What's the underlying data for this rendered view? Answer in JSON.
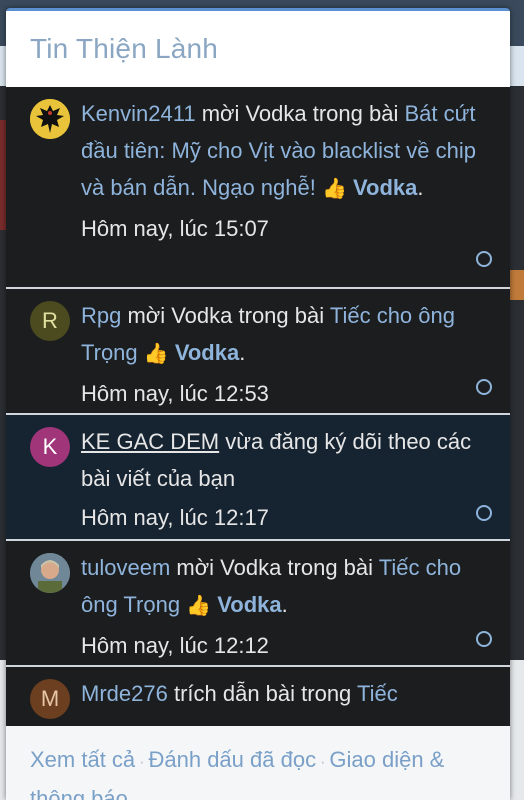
{
  "popup": {
    "title": "Tin Thiện Lành"
  },
  "items": [
    {
      "user": "Kenvin2411",
      "action": " mời Vodka trong bài ",
      "thread": "Bát cứt đầu tiên: Mỹ cho Vịt vào blacklist về chip và bán dẫn. Ngạo nghễ! ",
      "reaction_icon": "👍",
      "reaction_name": "Vodka",
      "suffix": ".",
      "time": "Hôm nay, lúc 15:07",
      "avatar_letter": "",
      "avatar_icon": "eagle-emblem-icon",
      "unread": false
    },
    {
      "user": "Rpg",
      "action": " mời Vodka trong bài ",
      "thread": "Tiếc cho ông Trọng ",
      "reaction_icon": "👍",
      "reaction_name": "Vodka",
      "suffix": ".",
      "time": "Hôm nay, lúc 12:53",
      "avatar_letter": "R",
      "avatar_color": "#4b4b1f",
      "unread": false
    },
    {
      "user": "KE GAC DEM",
      "action": " vừa đăng ký dõi theo các bài viết của bạn",
      "time": "Hôm nay, lúc 12:17",
      "avatar_letter": "K",
      "avatar_color": "#a0357a",
      "unread": true
    },
    {
      "user": "tuloveem",
      "action": " mời Vodka trong bài ",
      "thread": "Tiếc cho ông Trọng ",
      "reaction_icon": "👍",
      "reaction_name": "Vodka",
      "suffix": ".",
      "time": "Hôm nay, lúc 12:12",
      "avatar_letter": "",
      "avatar_icon": "photo-avatar-icon",
      "unread": false
    },
    {
      "user": "Mrde276",
      "action": " trích dẫn bài trong ",
      "thread": "Tiếc",
      "avatar_letter": "M",
      "avatar_color": "#6b3f1f",
      "unread": false
    }
  ],
  "footer": {
    "view_all": "Xem tất cả",
    "mark_read": "Đánh dấu đã đọc",
    "prefs": "Giao diện & thông báo",
    "separator": "·"
  }
}
